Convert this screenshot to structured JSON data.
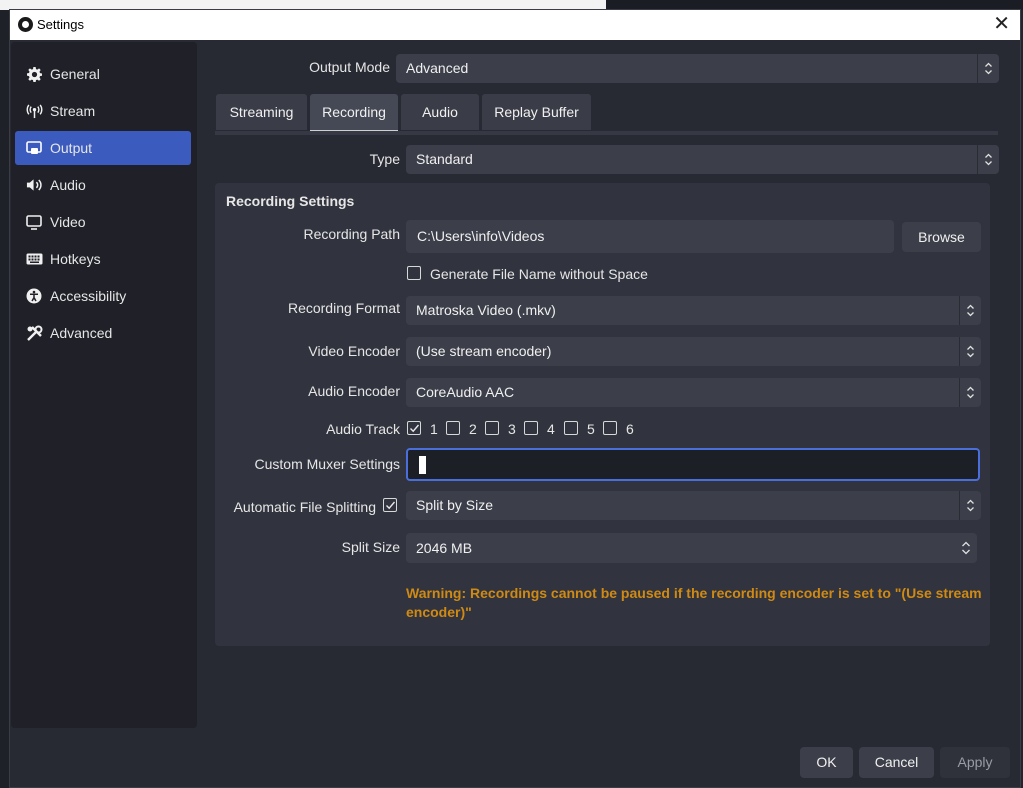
{
  "window": {
    "title": "Settings"
  },
  "sidebar": {
    "items": [
      {
        "label": "General",
        "icon": "gear-icon"
      },
      {
        "label": "Stream",
        "icon": "broadcast-icon"
      },
      {
        "label": "Output",
        "icon": "output-icon"
      },
      {
        "label": "Audio",
        "icon": "speaker-icon"
      },
      {
        "label": "Video",
        "icon": "monitor-icon"
      },
      {
        "label": "Hotkeys",
        "icon": "keyboard-icon"
      },
      {
        "label": "Accessibility",
        "icon": "accessibility-icon"
      },
      {
        "label": "Advanced",
        "icon": "tools-icon"
      }
    ],
    "active": "Output"
  },
  "output_mode": {
    "label": "Output Mode",
    "value": "Advanced"
  },
  "tabs": [
    {
      "label": "Streaming"
    },
    {
      "label": "Recording"
    },
    {
      "label": "Audio"
    },
    {
      "label": "Replay Buffer"
    }
  ],
  "active_tab": "Recording",
  "type": {
    "label": "Type",
    "value": "Standard"
  },
  "recording_settings": {
    "title": "Recording Settings",
    "path": {
      "label": "Recording Path",
      "value": "C:\\Users\\info\\Videos",
      "browse": "Browse"
    },
    "no_space": {
      "label": "Generate File Name without Space",
      "checked": false
    },
    "format": {
      "label": "Recording Format",
      "value": "Matroska Video (.mkv)"
    },
    "video_encoder": {
      "label": "Video Encoder",
      "value": "(Use stream encoder)"
    },
    "audio_encoder": {
      "label": "Audio Encoder",
      "value": "CoreAudio AAC"
    },
    "audio_track": {
      "label": "Audio Track",
      "tracks": [
        {
          "label": "1",
          "checked": true
        },
        {
          "label": "2",
          "checked": false
        },
        {
          "label": "3",
          "checked": false
        },
        {
          "label": "4",
          "checked": false
        },
        {
          "label": "5",
          "checked": false
        },
        {
          "label": "6",
          "checked": false
        }
      ]
    },
    "muxer": {
      "label": "Custom Muxer Settings",
      "value": ""
    },
    "file_splitting": {
      "label": "Automatic File Splitting",
      "checked": true,
      "value": "Split by Size"
    },
    "split_size": {
      "label": "Split Size",
      "value": "2046 MB"
    },
    "warning": "Warning: Recordings cannot be paused if the recording encoder is set to \"(Use stream encoder)\""
  },
  "buttons": {
    "ok": "OK",
    "cancel": "Cancel",
    "apply": "Apply"
  },
  "colors": {
    "accent": "#3b5bbf",
    "warning": "#d08a14",
    "focus": "#4a6fdc"
  }
}
